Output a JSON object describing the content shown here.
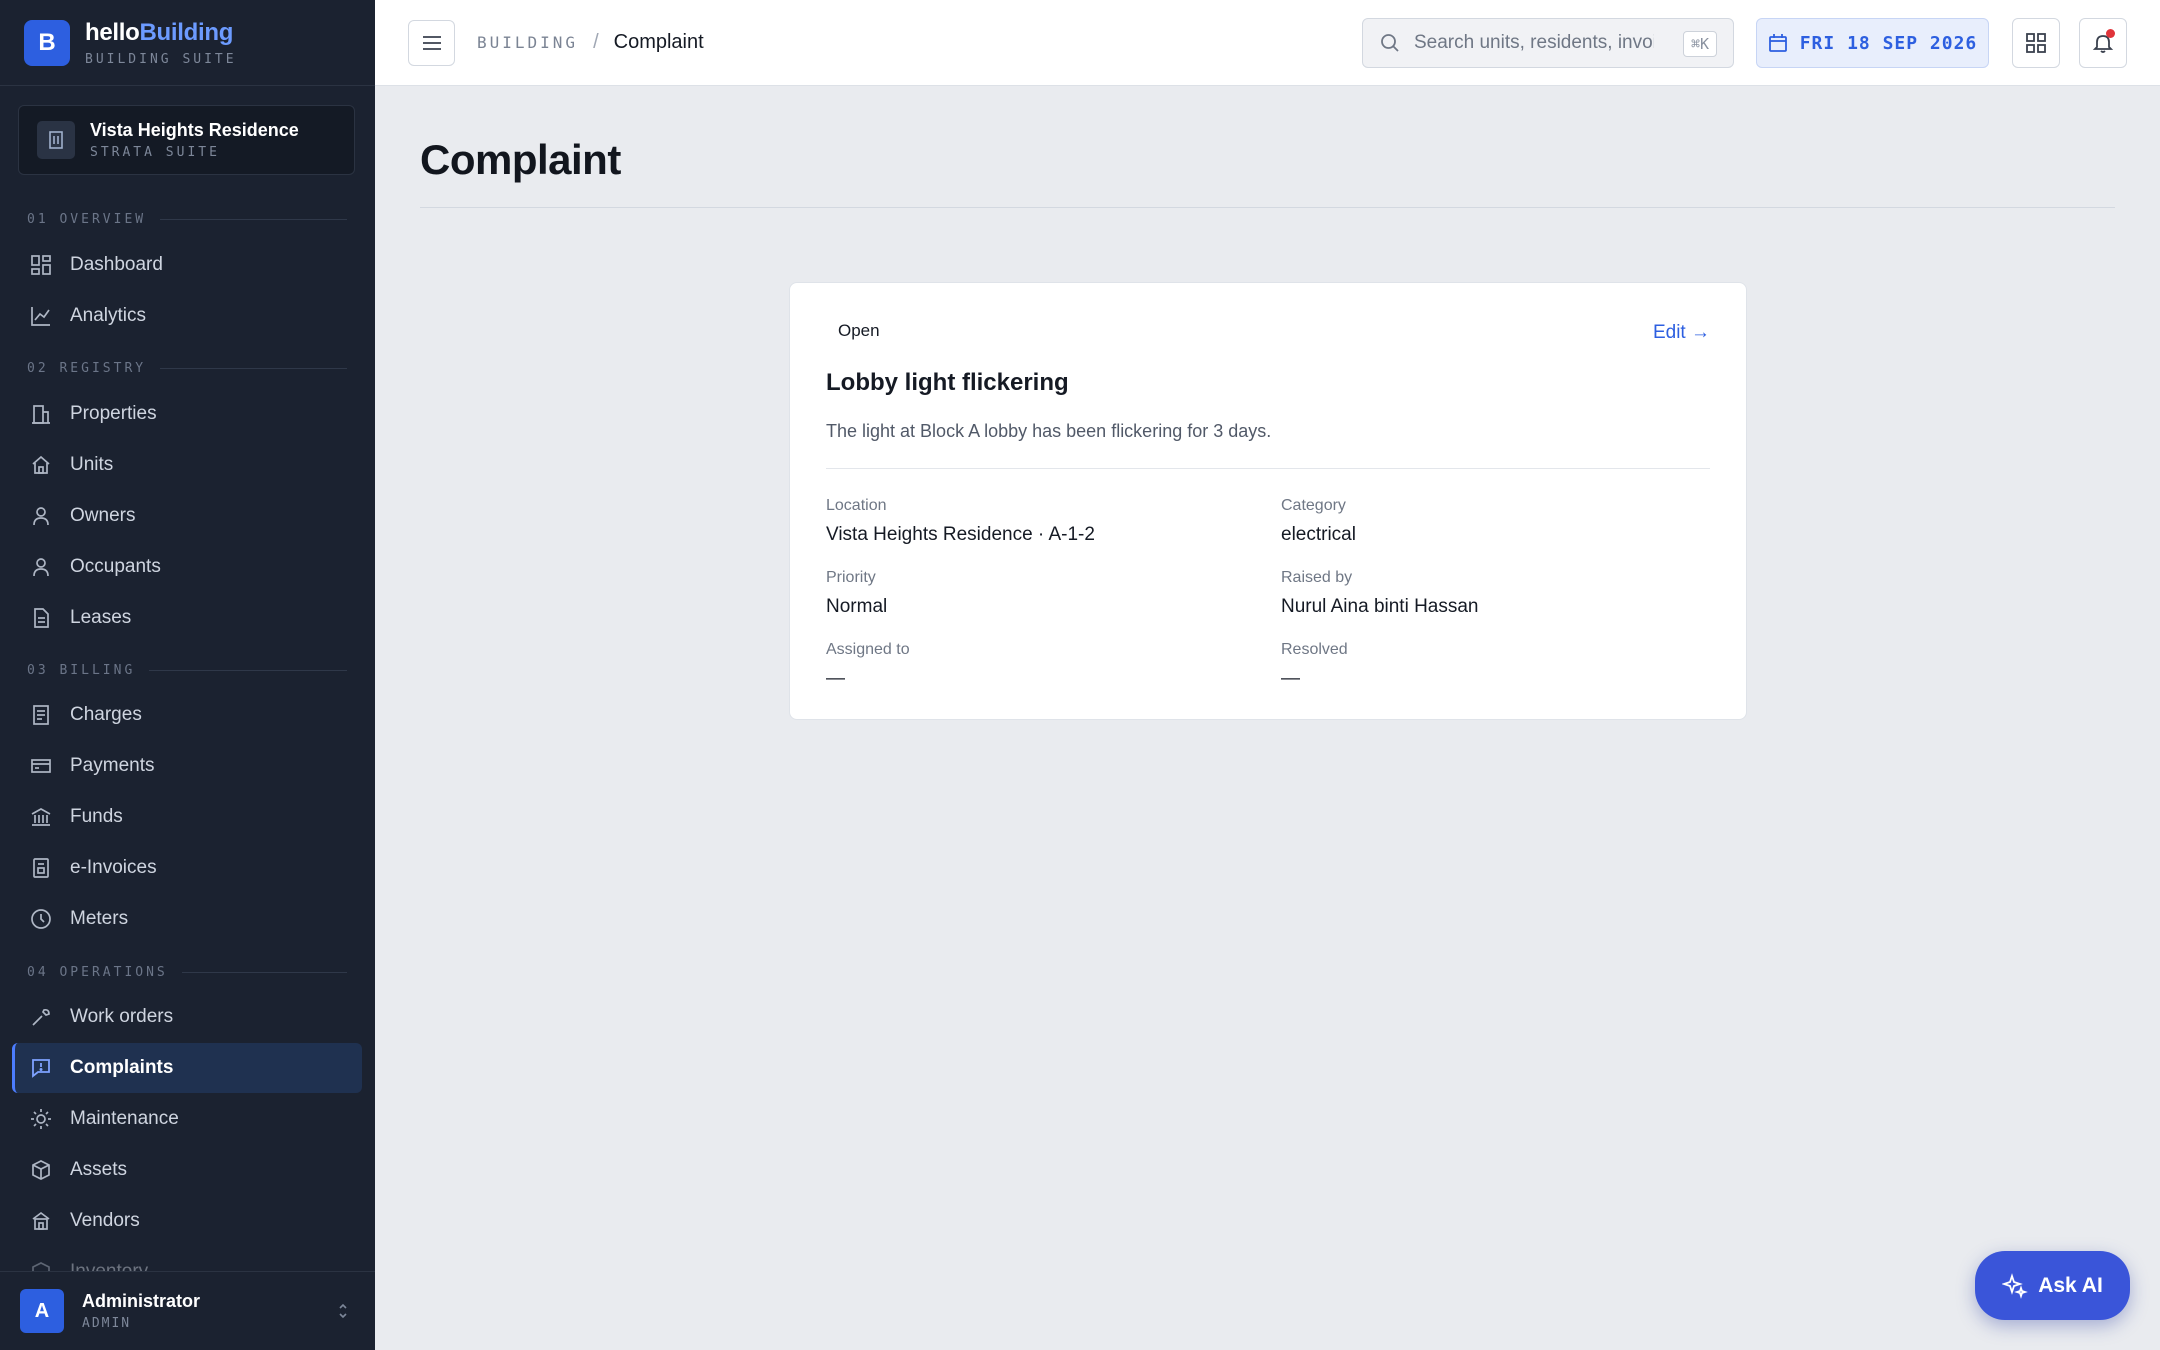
{
  "brand": {
    "name_prefix": "hello",
    "name_accent": "Building",
    "subtitle": "BUILDING SUITE",
    "logo_letter": "B",
    "accent_color": "#2d5fe0"
  },
  "property": {
    "name": "Vista Heights Residence",
    "subtitle": "STRATA SUITE"
  },
  "sidebar": {
    "sections": [
      {
        "label": "01 OVERVIEW",
        "items": [
          {
            "label": "Dashboard",
            "icon": "dashboard-icon"
          },
          {
            "label": "Analytics",
            "icon": "chart-line-icon"
          }
        ]
      },
      {
        "label": "02 REGISTRY",
        "items": [
          {
            "label": "Properties",
            "icon": "building-icon"
          },
          {
            "label": "Units",
            "icon": "home-icon"
          },
          {
            "label": "Owners",
            "icon": "person-icon"
          },
          {
            "label": "Occupants",
            "icon": "person-icon"
          },
          {
            "label": "Leases",
            "icon": "document-icon"
          }
        ]
      },
      {
        "label": "03 BILLING",
        "items": [
          {
            "label": "Charges",
            "icon": "receipt-icon"
          },
          {
            "label": "Payments",
            "icon": "card-icon"
          },
          {
            "label": "Funds",
            "icon": "bank-icon"
          },
          {
            "label": "e-Invoices",
            "icon": "invoice-icon"
          },
          {
            "label": "Meters",
            "icon": "gauge-icon"
          }
        ]
      },
      {
        "label": "04 OPERATIONS",
        "items": [
          {
            "label": "Work orders",
            "icon": "wrench-icon"
          },
          {
            "label": "Complaints",
            "icon": "message-alert-icon",
            "active": true
          },
          {
            "label": "Maintenance",
            "icon": "sun-icon"
          },
          {
            "label": "Assets",
            "icon": "box-icon"
          },
          {
            "label": "Vendors",
            "icon": "store-icon"
          },
          {
            "label": "Inventory",
            "icon": "box-icon"
          }
        ]
      }
    ]
  },
  "user": {
    "name": "Administrator",
    "role": "ADMIN",
    "initial": "A"
  },
  "topbar": {
    "breadcrumb_root": "BUILDING",
    "breadcrumb_sep": "/",
    "breadcrumb_current": "Complaint",
    "search_placeholder": "Search units, residents, invoi",
    "search_shortcut": "⌘K",
    "date": "FRI 18 SEP 2026"
  },
  "page": {
    "title": "Complaint"
  },
  "complaint": {
    "status": "Open",
    "edit_label": "Edit →",
    "title": "Lobby light flickering",
    "description": "The light at Block A lobby has been flickering for 3 days.",
    "fields": {
      "location": {
        "label": "Location",
        "value": "Vista Heights Residence · A-1-2"
      },
      "category": {
        "label": "Category",
        "value": "electrical"
      },
      "priority": {
        "label": "Priority",
        "value": "Normal"
      },
      "raised_by": {
        "label": "Raised by",
        "value": "Nurul Aina binti Hassan"
      },
      "assigned_to": {
        "label": "Assigned to",
        "value": "—"
      },
      "resolved": {
        "label": "Resolved",
        "value": "—"
      }
    }
  },
  "ask_ai": {
    "label": "Ask AI"
  }
}
